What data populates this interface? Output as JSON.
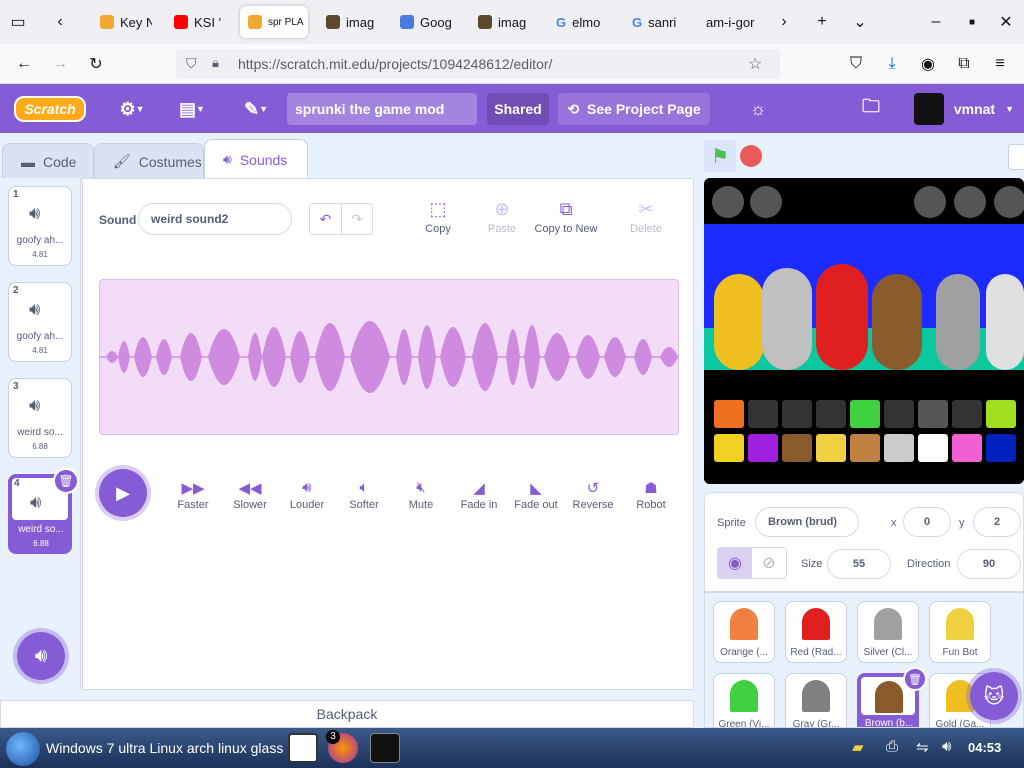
{
  "browser": {
    "tabs": [
      {
        "label": "Key N",
        "color": "#f0a830"
      },
      {
        "label": "KSI '",
        "color": "#ff0000"
      },
      {
        "label": "spr PLA",
        "color": "#f0a830"
      },
      {
        "label": "imag",
        "color": "#5a4a2a"
      },
      {
        "label": "Goog",
        "color": "#4a7be0"
      },
      {
        "label": "imag",
        "color": "#5a4a2a"
      },
      {
        "label": "elmo",
        "color": "#4285f4"
      },
      {
        "label": "sanri",
        "color": "#4285f4"
      },
      {
        "label": "am-i-gor",
        "color": ""
      }
    ],
    "url": "https://scratch.mit.edu/projects/1094248612/editor/"
  },
  "menubar": {
    "logo": "Scratch",
    "project_title": "sprunki the game mod",
    "shared_label": "Shared",
    "see_project_label": "See Project Page",
    "username": "vmnat",
    "accent": "#855cd6"
  },
  "editor_tabs": [
    {
      "label": "Code"
    },
    {
      "label": "Costumes"
    },
    {
      "label": "Sounds"
    }
  ],
  "sounds": [
    {
      "num": "1",
      "name": "goofy ah...",
      "duration": "4.81"
    },
    {
      "num": "2",
      "name": "goofy ah...",
      "duration": "4.81"
    },
    {
      "num": "3",
      "name": "weird so...",
      "duration": "6.88"
    },
    {
      "num": "4",
      "name": "weird so...",
      "duration": "6.88"
    }
  ],
  "sound_editor": {
    "sound_label": "Sound",
    "sound_name": "weird sound2",
    "tools": [
      {
        "label": "Copy"
      },
      {
        "label": "Paste"
      },
      {
        "label": "Copy to New"
      },
      {
        "label": "Delete"
      }
    ],
    "effects": [
      {
        "label": "Faster"
      },
      {
        "label": "Slower"
      },
      {
        "label": "Louder"
      },
      {
        "label": "Softer"
      },
      {
        "label": "Mute"
      },
      {
        "label": "Fade in"
      },
      {
        "label": "Fade out"
      },
      {
        "label": "Reverse"
      },
      {
        "label": "Robot"
      }
    ],
    "waveform_color": "#cf8be0"
  },
  "backpack_label": "Backpack",
  "sprite_info": {
    "sprite_label": "Sprite",
    "sprite_name": "Brown (brud)",
    "x_label": "x",
    "x_value": "0",
    "y_label": "y",
    "y_value": "2",
    "size_label": "Size",
    "size_value": "55",
    "direction_label": "Direction",
    "direction_value": "90"
  },
  "sprites": [
    {
      "name": "Orange (...",
      "color": "#f08040"
    },
    {
      "name": "Red (Rad...",
      "color": "#e02020"
    },
    {
      "name": "Silver (Cl...",
      "color": "#a0a0a0"
    },
    {
      "name": "Fun Bot",
      "color": "#f0d040"
    },
    {
      "name": "Green (Vi...",
      "color": "#40d040"
    },
    {
      "name": "Gray (Gr...",
      "color": "#808080"
    },
    {
      "name": "Brown (b...",
      "color": "#8a5a2a"
    },
    {
      "name": "Gold (Ga...",
      "color": "#f0c020"
    }
  ],
  "taskbar": {
    "title": "Windows 7 ultra Linux arch linux glass",
    "badge": "3",
    "clock": "04:53"
  }
}
